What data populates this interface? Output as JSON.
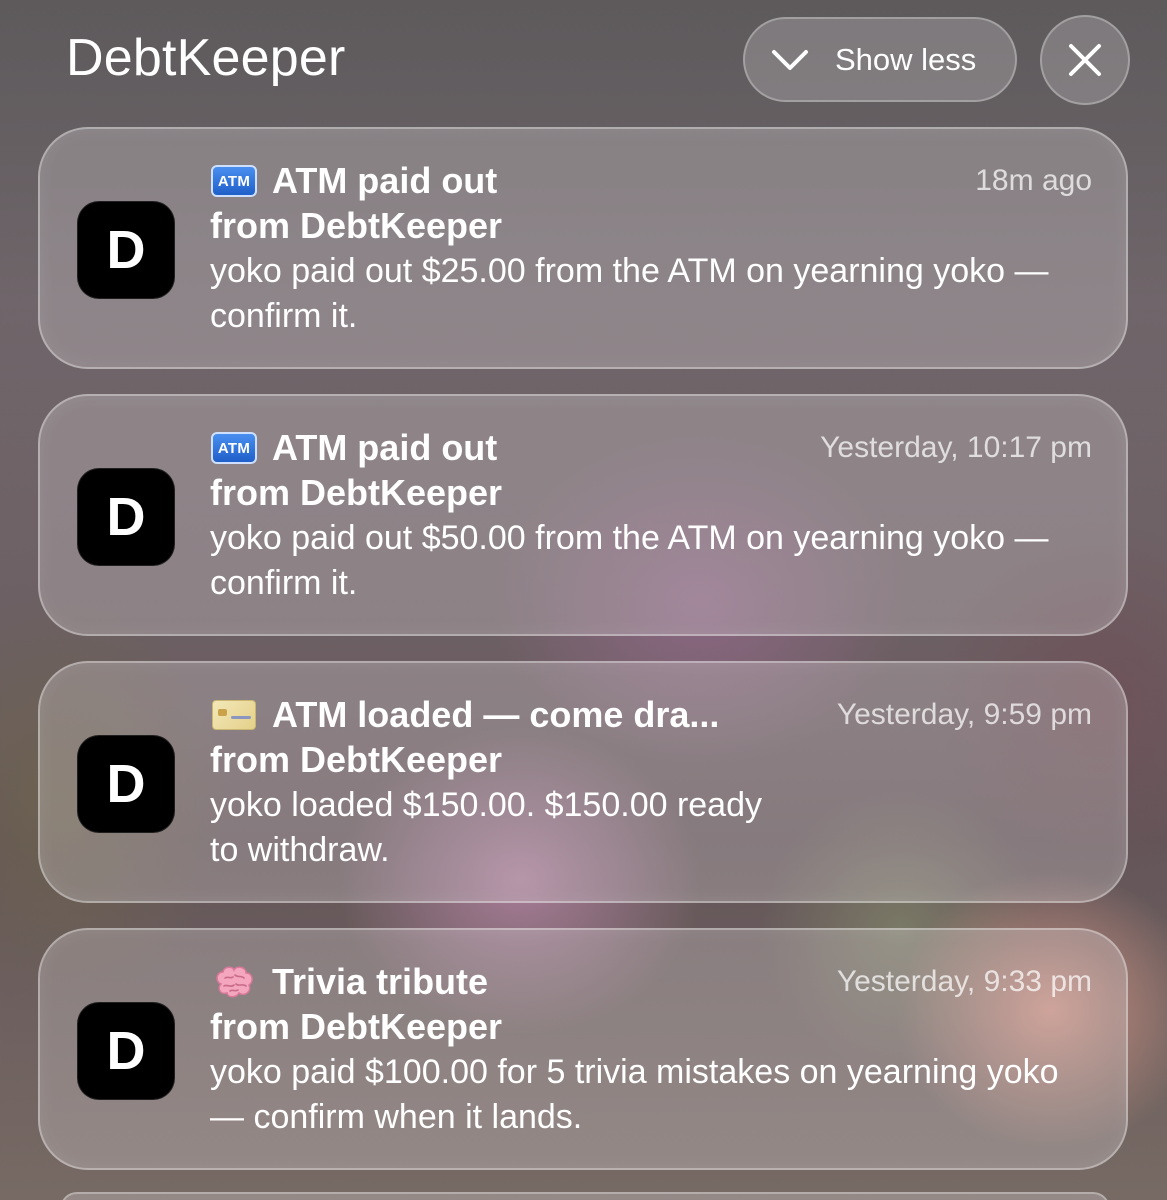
{
  "header": {
    "app_title": "DebtKeeper",
    "show_less_label": "Show less"
  },
  "notifications": [
    {
      "icon": "atm-emoji",
      "atm_badge": "ATM",
      "title": "ATM paid out",
      "time": "18m ago",
      "from": "from DebtKeeper",
      "body": "yoko paid out $25.00 from the ATM on yearning yoko — confirm it.",
      "avatar_letter": "D"
    },
    {
      "icon": "atm-emoji",
      "atm_badge": "ATM",
      "title": "ATM paid out",
      "time": "Yesterday, 10:17 pm",
      "from": "from DebtKeeper",
      "body": "yoko paid out $50.00 from the ATM on yearning yoko — confirm it.",
      "avatar_letter": "D"
    },
    {
      "icon": "credit-card-emoji",
      "title": "ATM loaded — come dra...",
      "time": "Yesterday, 9:59 pm",
      "from": "from DebtKeeper",
      "body_line1": "yoko loaded $150.00. $150.00 ready",
      "body_line2": "to withdraw.",
      "avatar_letter": "D"
    },
    {
      "icon": "brain-emoji",
      "title": "Trivia tribute",
      "time": "Yesterday, 9:33 pm",
      "from": "from DebtKeeper",
      "body": "yoko paid $100.00 for 5 trivia mistakes on yearning yoko — confirm when it lands.",
      "avatar_letter": "D"
    }
  ],
  "colors": {
    "card_fill": "#d7d2d5",
    "avatar_bg": "#000000",
    "atm_badge_blue": "#1f5fc9"
  }
}
